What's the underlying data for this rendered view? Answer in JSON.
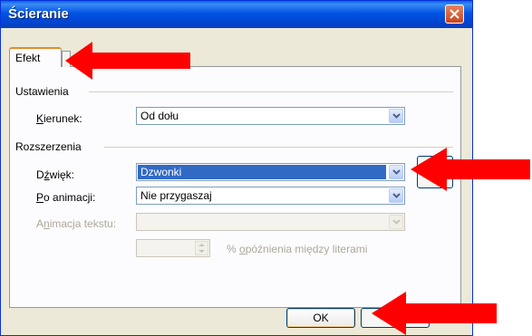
{
  "window": {
    "title": "Ścieranie"
  },
  "tabs": [
    {
      "label": "Efekt"
    }
  ],
  "groups": {
    "settings": "Ustawienia",
    "extensions": "Rozszerzenia"
  },
  "fields": {
    "direction": {
      "label_u": "K",
      "label_rest": "ierunek:",
      "value": "Od dołu"
    },
    "sound": {
      "label_pre": "D",
      "label_u": "ź",
      "label_rest": "więk:",
      "value": "Dzwonki"
    },
    "after": {
      "label_u": "P",
      "label_rest": "o animacji:",
      "value": "Nie przygaszaj"
    },
    "text_anim": {
      "label_pre": "A",
      "label_u": "n",
      "label_rest": "imacja tekstu:",
      "value": ""
    },
    "delay": {
      "value": "",
      "suffix_pre": "% ",
      "suffix_u": "o",
      "suffix_rest": "późnienia między literami"
    }
  },
  "buttons": {
    "ok": "OK"
  },
  "colors": {
    "annotation": "#ff0000",
    "titlebar": "#0054e3",
    "selection": "#316ac5"
  }
}
